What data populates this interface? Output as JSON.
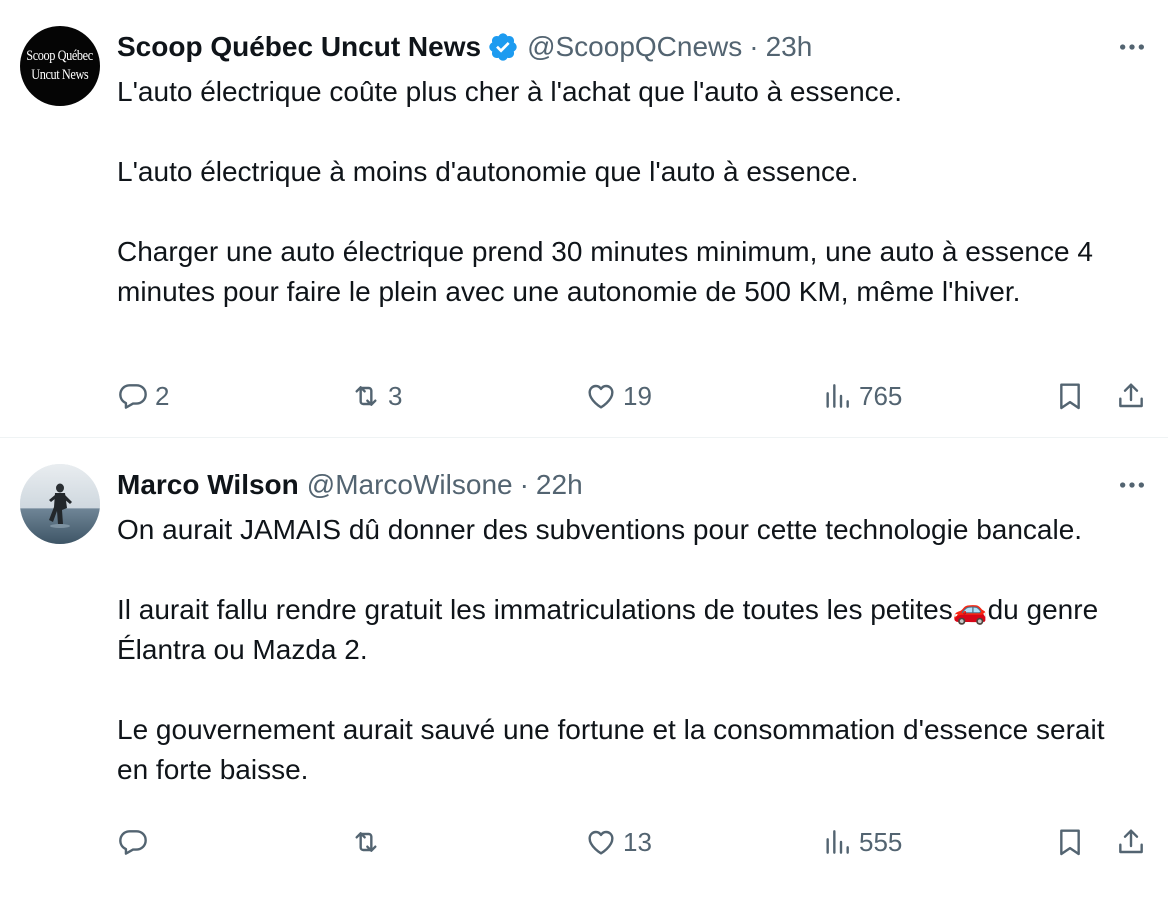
{
  "tweets": [
    {
      "avatar_text_line1": "Scoop Québec",
      "avatar_text_line2": "Uncut News",
      "name": "Scoop Québec Uncut News",
      "verified": true,
      "handle": "@ScoopQCnews",
      "separator": "·",
      "time": "23h",
      "paragraphs": [
        "L'auto électrique coûte plus cher à l'achat que l'auto à essence.",
        "L'auto électrique à moins d'autonomie que l'auto à essence.",
        "Charger une auto électrique prend 30 minutes minimum, une auto à essence 4 minutes pour faire le plein avec une autonomie de 500 KM, même l'hiver."
      ],
      "replies": "2",
      "reposts": "3",
      "likes": "19",
      "views": "765"
    },
    {
      "name": "Marco Wilson",
      "verified": false,
      "handle": "@MarcoWilsone",
      "separator": "·",
      "time": "22h",
      "paragraphs": [
        "On aurait JAMAIS dû donner des subventions pour cette technologie bancale.",
        "Il aurait fallu rendre gratuit les immatriculations de toutes les petites🚗du genre Élantra ou Mazda 2.",
        "Le gouvernement aurait sauvé une fortune et la consommation d'essence serait en forte baisse."
      ],
      "replies": "",
      "reposts": "",
      "likes": "13",
      "views": "555"
    }
  ],
  "colors": {
    "text": "#0f1419",
    "secondary": "#536471",
    "verified": "#1d9bf0",
    "divider": "#eff3f4"
  },
  "icons": [
    "reply-icon",
    "repost-icon",
    "like-icon",
    "views-icon",
    "bookmark-icon",
    "share-icon",
    "more-icon",
    "verified-badge-icon"
  ]
}
